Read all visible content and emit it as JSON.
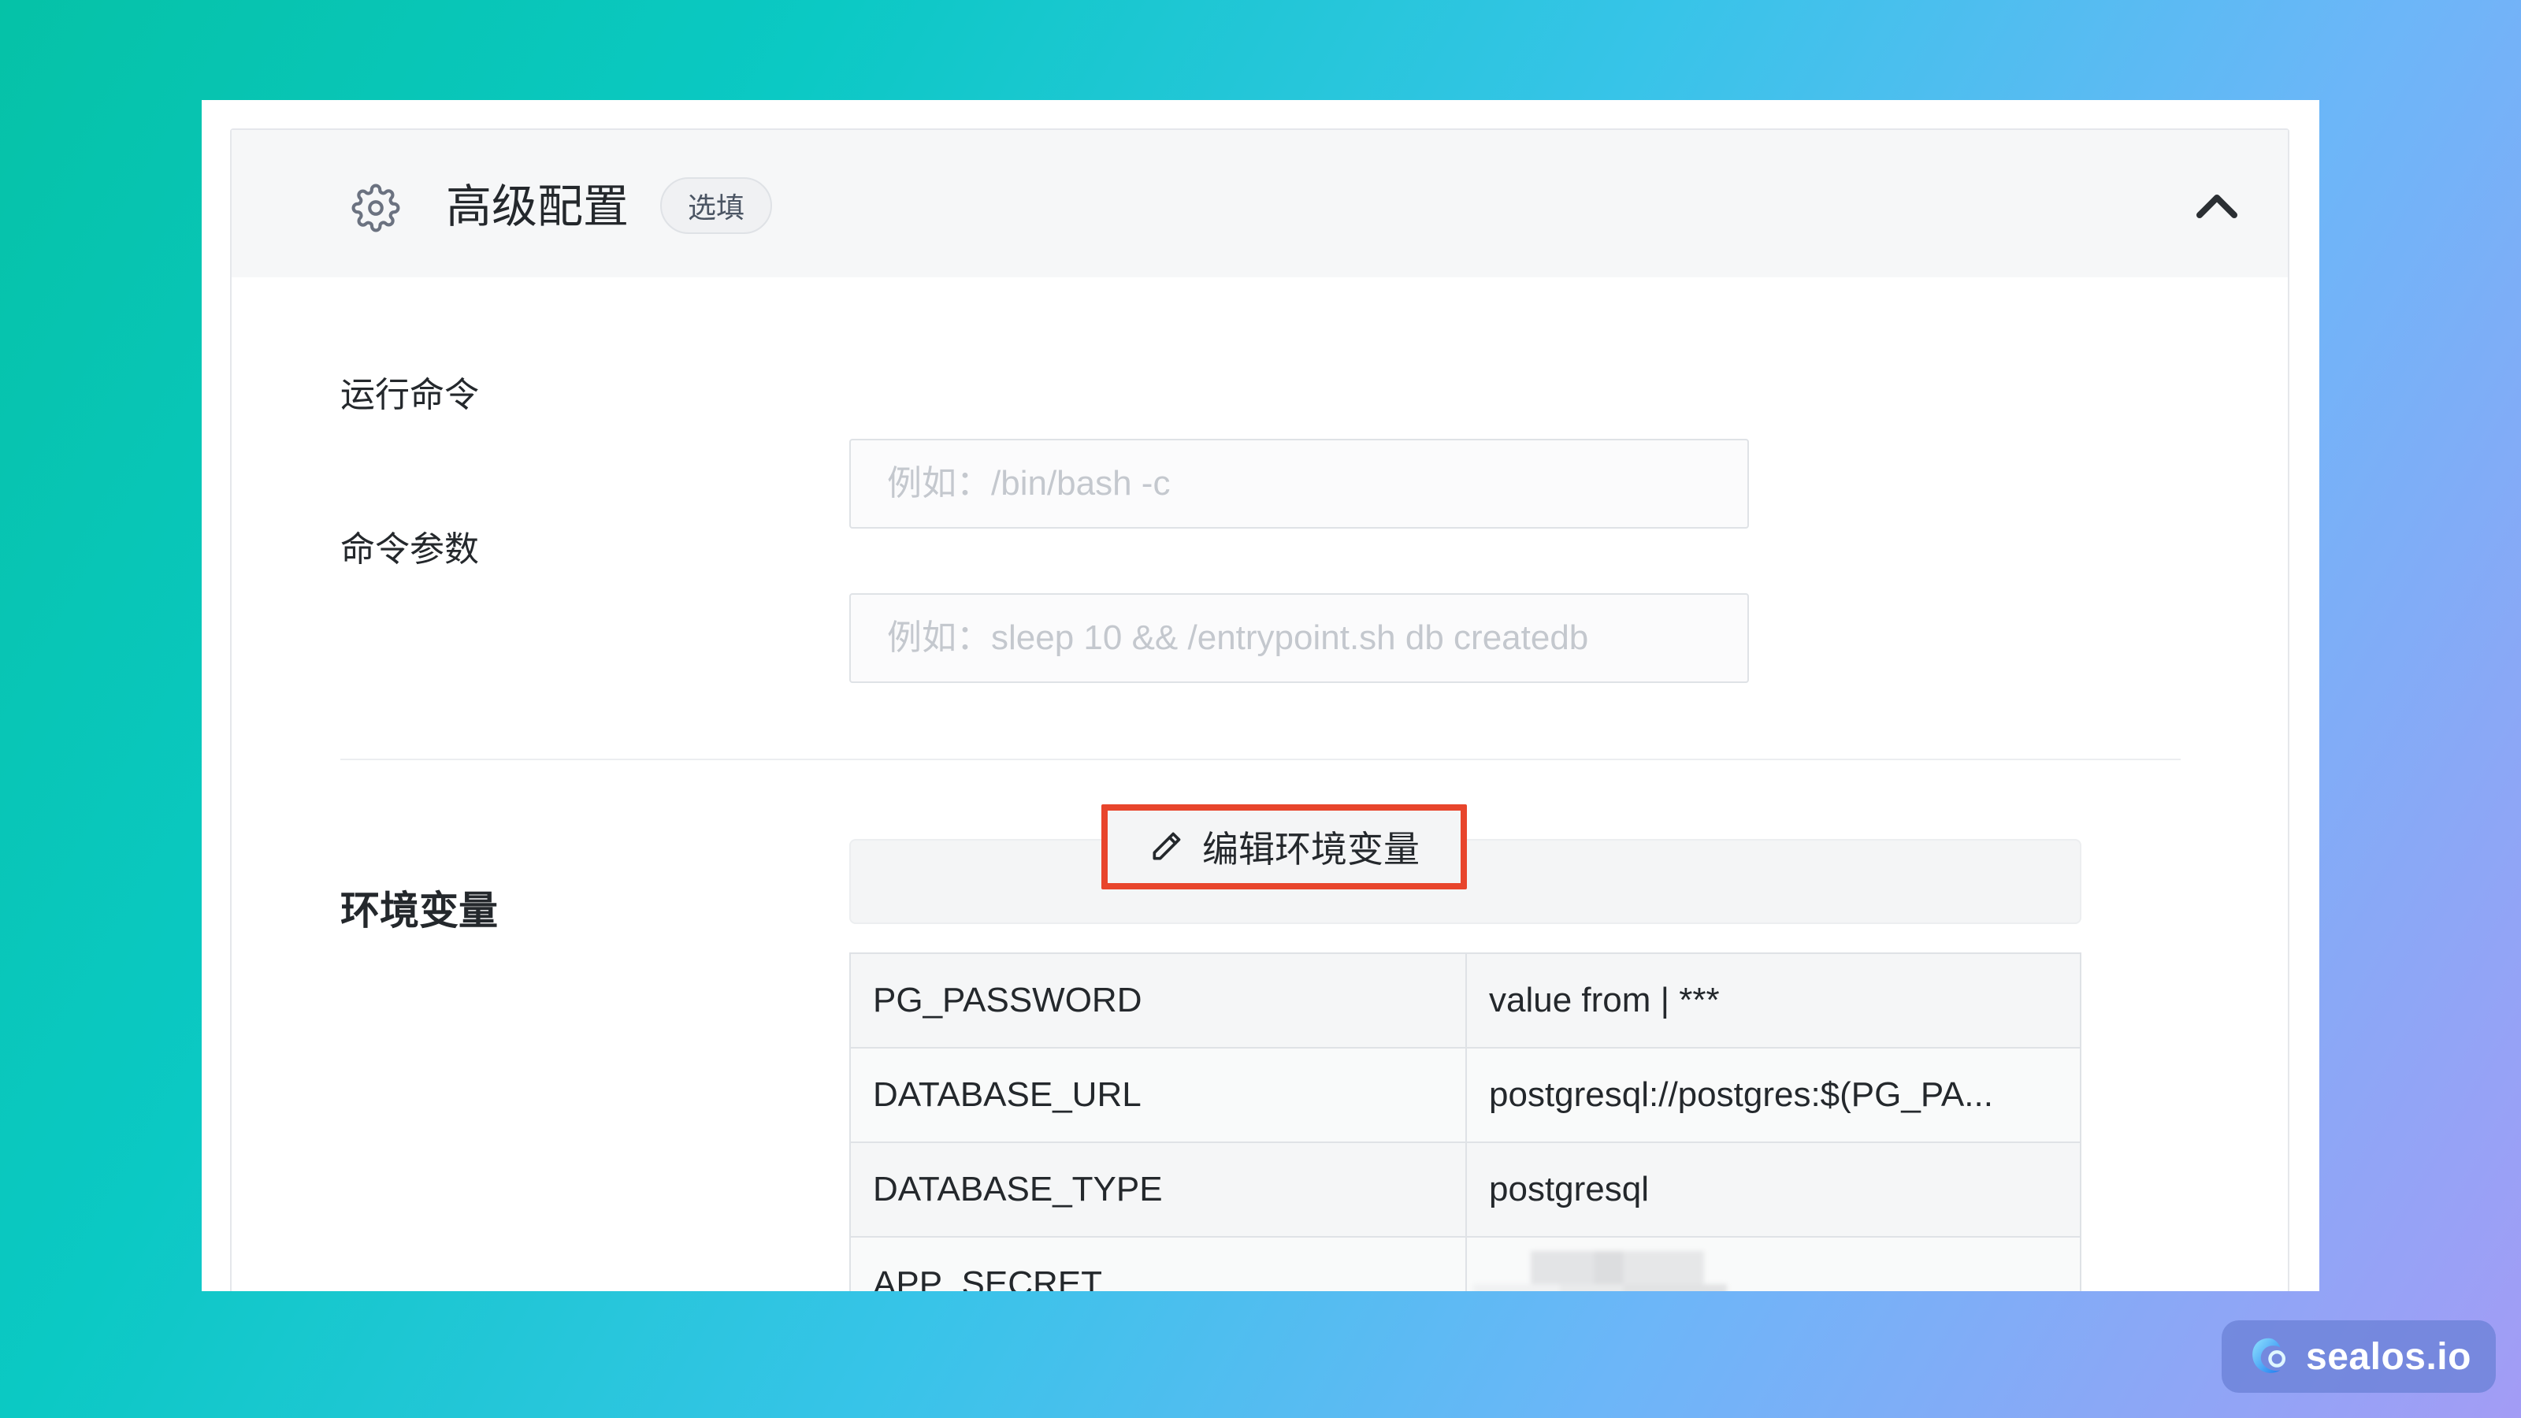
{
  "panel": {
    "title": "高级配置",
    "badge": "选填",
    "icon": "gear-icon",
    "collapse_icon": "chevron-up-icon"
  },
  "form": {
    "run_command": {
      "label": "运行命令",
      "placeholder": "例如：/bin/bash -c",
      "value": ""
    },
    "command_args": {
      "label": "命令参数",
      "placeholder": "例如：sleep 10 && /entrypoint.sh db createdb",
      "value": ""
    }
  },
  "env": {
    "title": "环境变量",
    "edit_button_label": "编辑环境变量",
    "edit_icon": "pencil-icon",
    "highlight_color": "#e8452c",
    "rows": [
      {
        "key": "PG_PASSWORD",
        "value": "value from | ***"
      },
      {
        "key": "DATABASE_URL",
        "value": "postgresql://postgres:$(PG_PA..."
      },
      {
        "key": "DATABASE_TYPE",
        "value": "postgresql"
      },
      {
        "key": "APP_SECRET",
        "value": ""
      }
    ]
  },
  "brand": {
    "text": "sealos.io",
    "icon": "sealos-logo-icon"
  }
}
